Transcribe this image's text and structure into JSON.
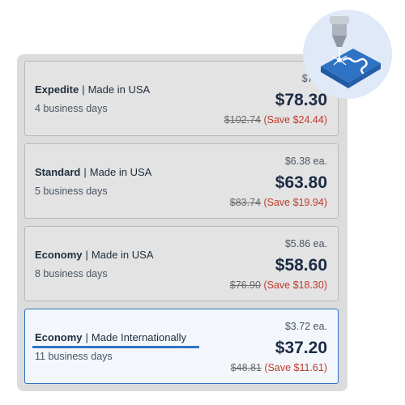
{
  "options": [
    {
      "type": "Expedite",
      "origin": "Made in USA",
      "days": "4 business days",
      "unit_price": "$7.83",
      "price": "$78.30",
      "original": "$102.74",
      "save": "(Save $24.44)",
      "selected": false
    },
    {
      "type": "Standard",
      "origin": "Made in USA",
      "days": "5 business days",
      "unit_price": "$6.38 ea.",
      "price": "$63.80",
      "original": "$83.74",
      "save": "(Save $19.94)",
      "selected": false
    },
    {
      "type": "Economy",
      "origin": "Made in USA",
      "days": "8 business days",
      "unit_price": "$5.86 ea.",
      "price": "$58.60",
      "original": "$76.90",
      "save": "(Save $18.30)",
      "selected": false
    },
    {
      "type": "Economy",
      "origin": "Made Internationally",
      "days": "11 business days",
      "unit_price": "$3.72 ea.",
      "price": "$37.20",
      "original": "$48.81",
      "save": "(Save $11.61)",
      "selected": true
    }
  ],
  "separator": "|",
  "colors": {
    "accent": "#2f73c4",
    "save": "#c0392b",
    "price": "#1c2b44",
    "badge_bg": "#dfe9f7"
  },
  "icons": {
    "badge": "laser-cutter-icon"
  }
}
